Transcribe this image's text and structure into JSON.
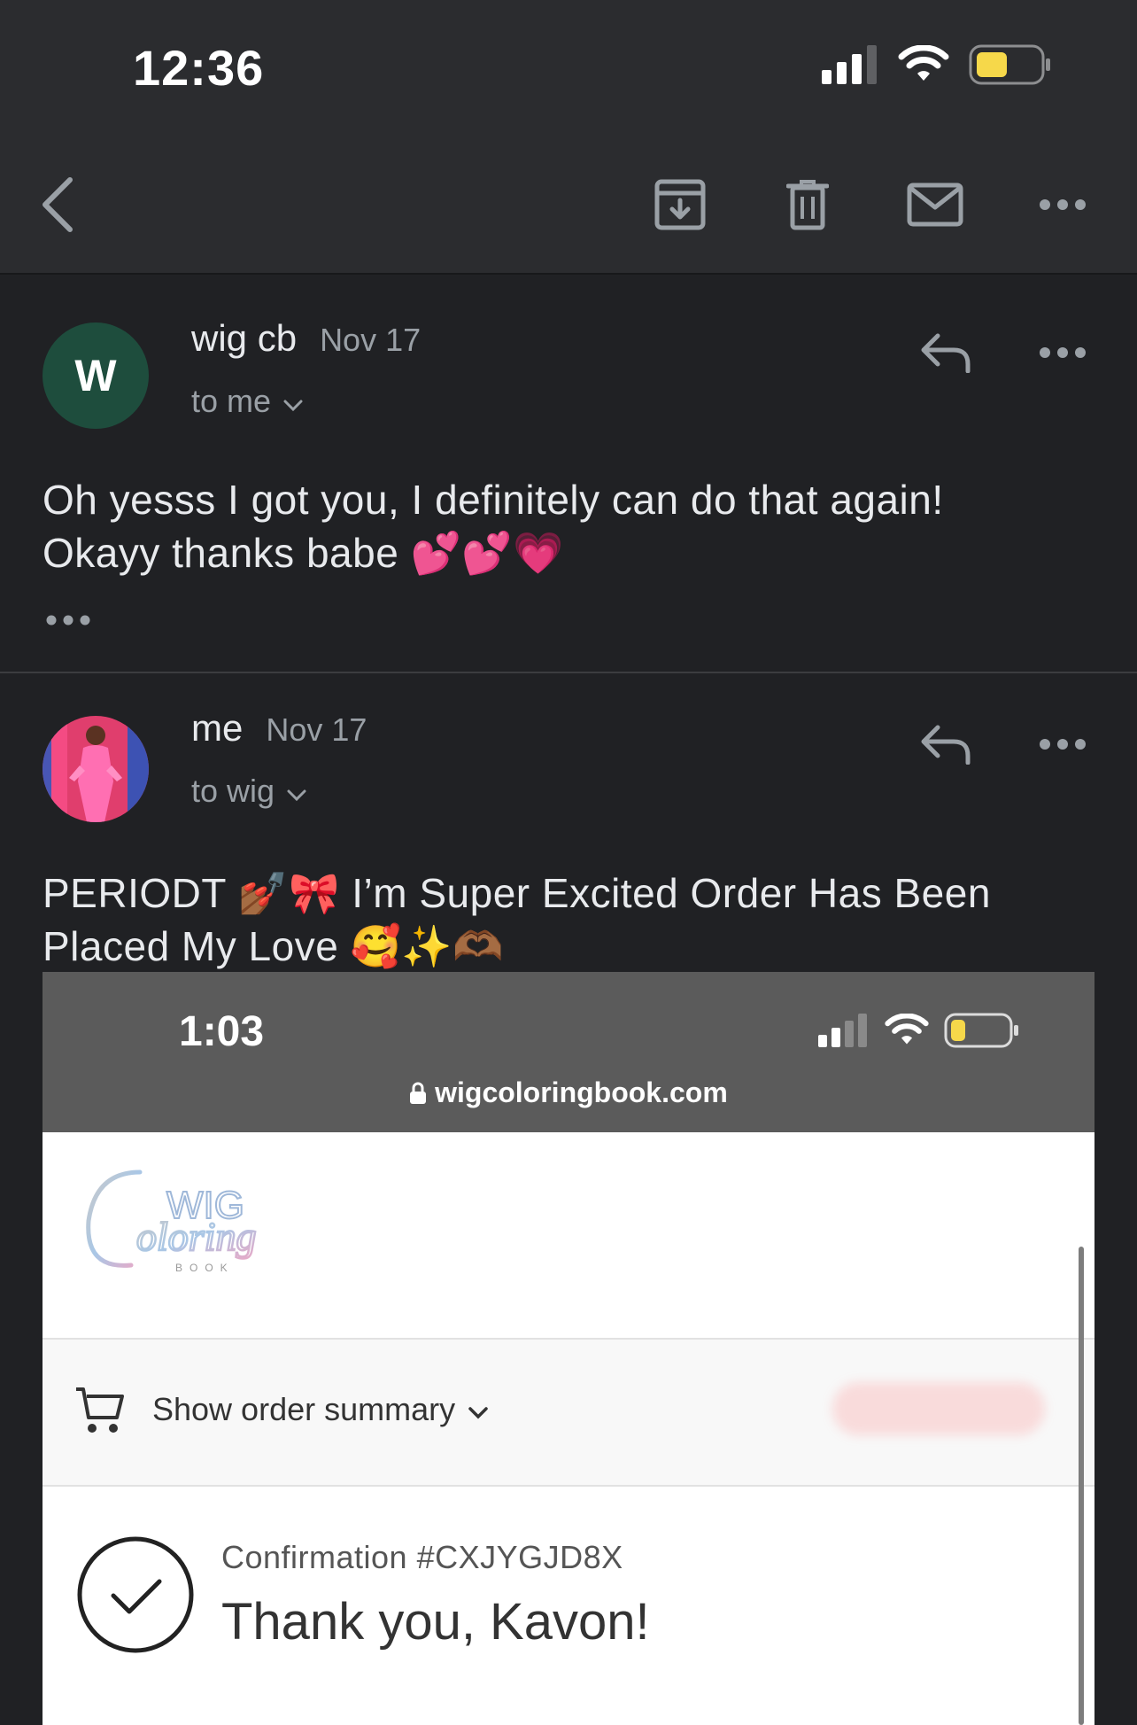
{
  "status_bar": {
    "time": "12:36"
  },
  "toolbar": {
    "back": "back-icon",
    "archive": "archive-icon",
    "delete": "trash-icon",
    "mark_unread": "mail-icon",
    "more": "more-horizontal-icon"
  },
  "messages": [
    {
      "avatar_letter": "W",
      "sender": "wig cb",
      "date": "Nov 17",
      "recipient": "to me",
      "body_line1": "Oh yesss I got you, I definitely can do that again!",
      "body_line2": "Okayy thanks babe",
      "body_emoji": "💕💕💗"
    },
    {
      "sender": "me",
      "date": "Nov 17",
      "recipient": "to wig",
      "body_line1_text": "PERIODT",
      "body_line1_emoji": "💅🏾🎀",
      "body_line1_rest": "I’m Super Excited Order Has Been",
      "body_line2": "Placed My Love",
      "body_line2_emoji": "🥰✨🫶🏾"
    }
  ],
  "embedded_screenshot": {
    "time": "1:03",
    "url": "wigcoloringbook.com",
    "logo": "WIG Coloring BOOK",
    "order_summary": "Show order summary",
    "confirmation": "Confirmation #CXJYGJD8X",
    "thanks": "Thank you, Kavon!"
  },
  "colors": {
    "background": "#202124",
    "toolbar": "#2b2c2f",
    "avatar_w": "#1e4d3d",
    "battery": "#f6d84a"
  }
}
